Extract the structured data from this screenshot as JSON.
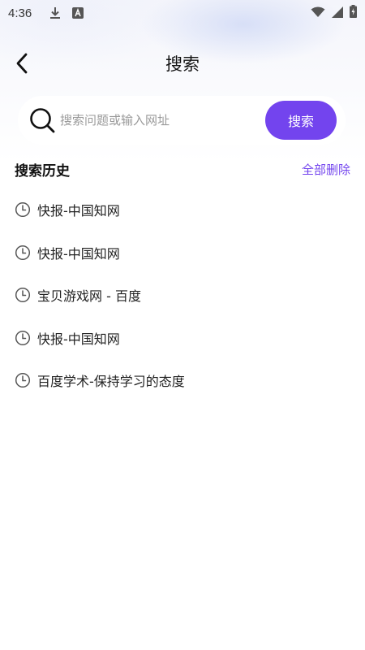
{
  "status_bar": {
    "time": "4:36",
    "icons": [
      "download-icon",
      "a-badge-icon",
      "wifi-icon",
      "signal-icon",
      "battery-icon"
    ]
  },
  "nav": {
    "title": "搜索",
    "back_icon": "back-arrow-icon"
  },
  "search": {
    "placeholder": "搜索问题或输入网址",
    "value": "",
    "button_label": "搜索",
    "icon": "search-icon"
  },
  "history": {
    "title": "搜索历史",
    "delete_all_label": "全部删除",
    "items": [
      {
        "text": "快报-中国知网"
      },
      {
        "text": "快报-中国知网"
      },
      {
        "text": "宝贝游戏网 - 百度"
      },
      {
        "text": "快报-中国知网"
      },
      {
        "text": "百度学术-保持学习的态度"
      }
    ]
  },
  "colors": {
    "accent": "#7344ee",
    "text": "#222222",
    "placeholder": "#9a9a9a"
  }
}
